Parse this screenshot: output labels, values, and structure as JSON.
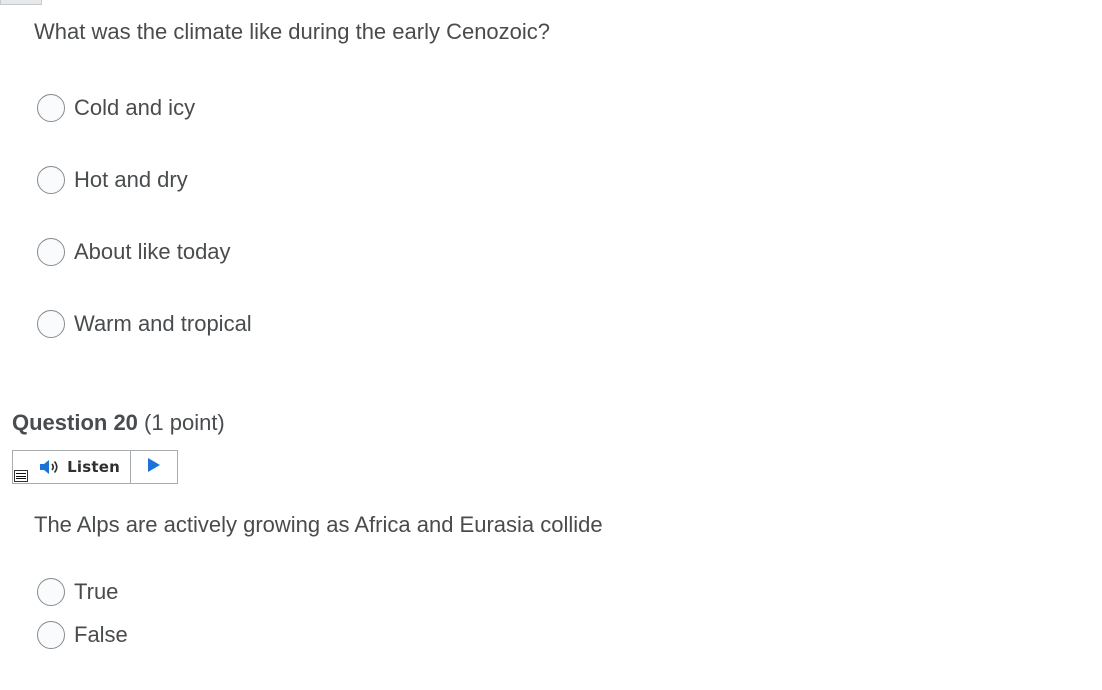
{
  "q19": {
    "prompt": "What was the climate like during the early Cenozoic?",
    "options": [
      {
        "label": "Cold and icy"
      },
      {
        "label": "Hot and dry"
      },
      {
        "label": "About like today"
      },
      {
        "label": "Warm and tropical"
      }
    ]
  },
  "q20": {
    "title": "Question 20",
    "points": "(1 point)",
    "listen": {
      "label": "Listen",
      "speaker_icon": "speaker-icon",
      "play_icon": "play-icon",
      "menu_icon": "menu-icon"
    },
    "prompt": "The Alps are actively growing as Africa and Eurasia collide",
    "options": [
      {
        "label": "True"
      },
      {
        "label": "False"
      }
    ]
  },
  "colors": {
    "text": "#494c4e",
    "radio_border": "#868c8f",
    "play_blue": "#1a73d9"
  }
}
